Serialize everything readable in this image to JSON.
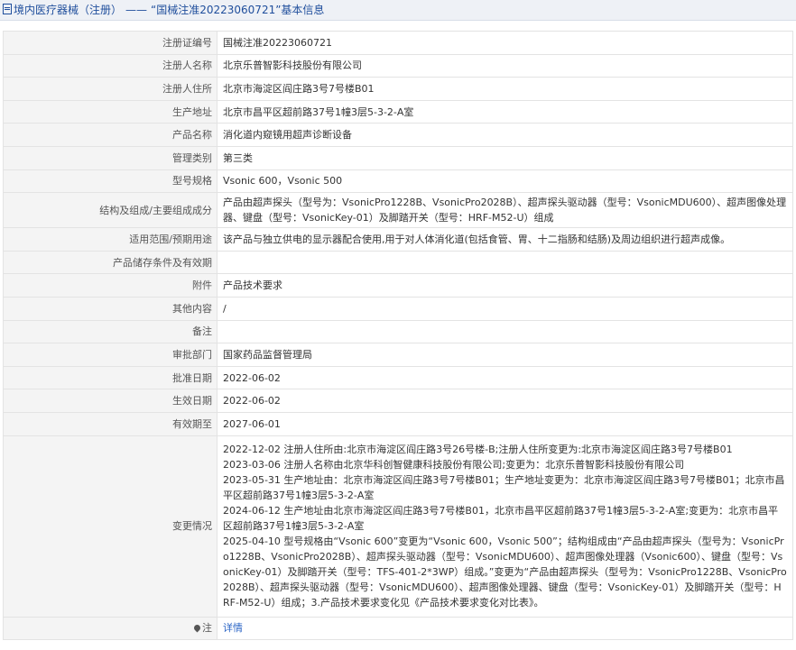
{
  "header": {
    "category": "境内医疗器械（注册）",
    "separator": "——",
    "title": "“国械注准20223060721”基本信息"
  },
  "rows": [
    {
      "label": "注册证编号",
      "value": "国械注准20223060721"
    },
    {
      "label": "注册人名称",
      "value": "北京乐普智影科技股份有限公司"
    },
    {
      "label": "注册人住所",
      "value": "北京市海淀区阎庄路3号7号楼B01"
    },
    {
      "label": "生产地址",
      "value": "北京市昌平区超前路37号1幢3层5-3-2-A室"
    },
    {
      "label": "产品名称",
      "value": "消化道内窥镜用超声诊断设备"
    },
    {
      "label": "管理类别",
      "value": "第三类"
    },
    {
      "label": "型号规格",
      "value": "Vsonic 600，Vsonic 500"
    },
    {
      "label": "结构及组成/主要组成成分",
      "value": "产品由超声探头（型号为：VsonicPro1228B、VsonicPro2028B）、超声探头驱动器（型号：VsonicMDU600）、超声图像处理器、键盘（型号：VsonicKey-01）及脚踏开关（型号：HRF-M52-U）组成"
    },
    {
      "label": "适用范围/预期用途",
      "value": "该产品与独立供电的显示器配合使用,用于对人体消化道(包括食管、胃、十二指肠和结肠)及周边组织进行超声成像。"
    },
    {
      "label": "产品储存条件及有效期",
      "value": ""
    },
    {
      "label": "附件",
      "value": "产品技术要求"
    },
    {
      "label": "其他内容",
      "value": "/"
    },
    {
      "label": "备注",
      "value": ""
    },
    {
      "label": "审批部门",
      "value": "国家药品监督管理局"
    },
    {
      "label": "批准日期",
      "value": "2022-06-02"
    },
    {
      "label": "生效日期",
      "value": "2022-06-02"
    },
    {
      "label": "有效期至",
      "value": "2027-06-01"
    }
  ],
  "changes": {
    "label": "变更情况",
    "entries": [
      "2022-12-02 注册人住所由:北京市海淀区阎庄路3号26号楼-B;注册人住所变更为:北京市海淀区阎庄路3号7号楼B01",
      "2023-03-06 注册人名称由北京华科创智健康科技股份有限公司;变更为：北京乐普智影科技股份有限公司",
      "2023-05-31 生产地址由：北京市海淀区阎庄路3号7号楼B01；生产地址变更为：北京市海淀区阎庄路3号7号楼B01；北京市昌平区超前路37号1幢3层5-3-2-A室",
      "2024-06-12 生产地址由北京市海淀区阎庄路3号7号楼B01，北京市昌平区超前路37号1幢3层5-3-2-A室;变更为：北京市昌平区超前路37号1幢3层5-3-2-A室",
      "2025-04-10 型号规格由“Vsonic 600”变更为“Vsonic 600，Vsonic 500”；结构组成由“产品由超声探头（型号为：VsonicPro1228B、VsonicPro2028B）、超声探头驱动器（型号：VsonicMDU600）、超声图像处理器（Vsonic600）、键盘（型号：VsonicKey-01）及脚踏开关（型号：TFS-401-2*3WP）组成。”变更为“产品由超声探头（型号为：VsonicPro1228B、VsonicPro2028B）、超声探头驱动器（型号：VsonicMDU600）、超声图像处理器、键盘（型号：VsonicKey-01）及脚踏开关（型号：HRF-M52-U）组成；3.产品技术要求变化见《产品技术要求变化对比表》。"
    ]
  },
  "note": {
    "icon": "pin-icon",
    "label": "注",
    "link_text": "详情"
  }
}
